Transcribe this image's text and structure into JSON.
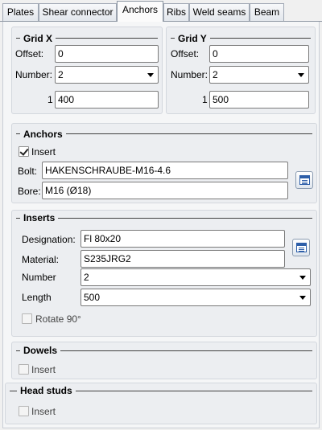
{
  "tabs": [
    {
      "label": "Plates",
      "active": false
    },
    {
      "label": "Shear connector",
      "active": false
    },
    {
      "label": "Anchors",
      "active": true
    },
    {
      "label": "Ribs",
      "active": false
    },
    {
      "label": "Weld seams",
      "active": false
    },
    {
      "label": "Beam",
      "active": false
    }
  ],
  "grid_x": {
    "title": "Grid X",
    "offset_label": "Offset:",
    "offset_value": "0",
    "number_label": "Number:",
    "number_value": "2",
    "row_index": "1",
    "row_value": "400"
  },
  "grid_y": {
    "title": "Grid Y",
    "offset_label": "Offset:",
    "offset_value": "0",
    "number_label": "Number:",
    "number_value": "2",
    "row_index": "1",
    "row_value": "500"
  },
  "anchors": {
    "title": "Anchors",
    "insert_label": "Insert",
    "insert_checked": true,
    "bolt_label": "Bolt:",
    "bolt_value": "HAKENSCHRAUBE-M16-4.6",
    "bore_label": "Bore:",
    "bore_value": "M16 (Ø18)",
    "list_icon": "table-list-icon"
  },
  "inserts": {
    "title": "Inserts",
    "designation_label": "Designation:",
    "designation_value": "Fl 80x20",
    "material_label": "Material:",
    "material_value": "S235JRG2",
    "number_label": "Number",
    "number_value": "2",
    "length_label": "Length",
    "length_value": "500",
    "rotate_label": "Rotate 90°",
    "rotate_checked": false,
    "list_icon": "table-list-icon"
  },
  "dowels": {
    "title": "Dowels",
    "insert_label": "Insert",
    "insert_checked": false
  },
  "head_studs": {
    "title": "Head studs",
    "insert_label": "Insert",
    "insert_checked": false
  }
}
